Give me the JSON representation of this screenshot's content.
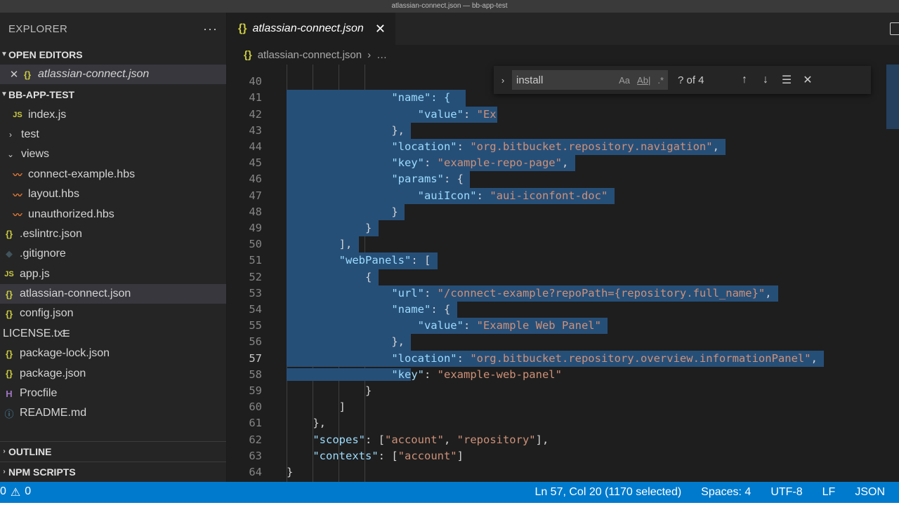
{
  "window": {
    "title": "atlassian-connect.json — bb-app-test"
  },
  "explorer": {
    "title": "EXPLORER",
    "more_icon": "ellipsis-icon",
    "open_editors_label": "OPEN EDITORS",
    "open_editor_file": "atlassian-connect.json",
    "project_label": "BB-APP-TEST",
    "files": [
      {
        "name": "index.js",
        "icon": "js"
      },
      {
        "name": "test",
        "icon": "folder-collapsed"
      },
      {
        "name": "views",
        "icon": "folder-expanded"
      },
      {
        "name": "connect-example.hbs",
        "icon": "hbs"
      },
      {
        "name": "layout.hbs",
        "icon": "hbs"
      },
      {
        "name": "unauthorized.hbs",
        "icon": "hbs"
      },
      {
        "name": ".eslintrc.json",
        "icon": "json"
      },
      {
        "name": ".gitignore",
        "icon": "git"
      },
      {
        "name": "app.js",
        "icon": "js"
      },
      {
        "name": "atlassian-connect.json",
        "icon": "json"
      },
      {
        "name": "config.json",
        "icon": "json"
      },
      {
        "name": "LICENSE.txt",
        "icon": "txt"
      },
      {
        "name": "package-lock.json",
        "icon": "json"
      },
      {
        "name": "package.json",
        "icon": "json"
      },
      {
        "name": "Procfile",
        "icon": "procfile"
      },
      {
        "name": "README.md",
        "icon": "info"
      }
    ],
    "outline_label": "OUTLINE",
    "npm_scripts_label": "NPM SCRIPTS"
  },
  "editor": {
    "tab_label": "atlassian-connect.json",
    "breadcrumb_file": "atlassian-connect.json",
    "breadcrumb_more": "…",
    "lines": {
      "n40": "40",
      "t40a": "\"name\": {",
      "t40b": "Ex",
      "n41": "41",
      "t41k": "\"value\"",
      "t41s": "\"Ex",
      "n42": "42",
      "t42": "},",
      "n43": "43",
      "t43k": "\"location\"",
      "t43s": "\"org.bitbucket.repository.navigation\"",
      "n44": "44",
      "t44k": "\"key\"",
      "t44s": "\"example-repo-page\"",
      "n45": "45",
      "t45k": "\"params\"",
      "t45p": ": {",
      "n46": "46",
      "t46k": "\"auiIcon\"",
      "t46s": "\"aui-iconfont-doc\"",
      "n47": "47",
      "t47": "}",
      "n48": "48",
      "t48": "}",
      "n49": "49",
      "t49": "],",
      "n50": "50",
      "t50k": "\"webPanels\"",
      "t50p": ": [",
      "n51": "51",
      "t51": "{",
      "n52": "52",
      "t52k": "\"url\"",
      "t52s": "\"/connect-example?repoPath={repository.full_name}\"",
      "n53": "53",
      "t53k": "\"name\"",
      "t53p": ": {",
      "n54": "54",
      "t54k": "\"value\"",
      "t54s": "\"Example Web Panel\"",
      "n55": "55",
      "t55": "},",
      "n56": "56",
      "t56k": "\"location\"",
      "t56s": "\"org.bitbucket.repository.overview.informationPanel\"",
      "n57": "57",
      "t57ka": "\"ke",
      "t57kb": "y\"",
      "t57s": "\"example-web-panel\"",
      "n58": "58",
      "t58": "}",
      "n59": "59",
      "t59": "]",
      "n60": "60",
      "t60": "},",
      "n61": "61",
      "t61k": "\"scopes\"",
      "t61a": ": [",
      "t61s1": "\"account\"",
      "t61c": ", ",
      "t61s2": "\"repository\"",
      "t61e": "],",
      "n62": "62",
      "t62k": "\"contexts\"",
      "t62a": ": [",
      "t62s1": "\"account\"",
      "t62e": "]",
      "n63": "63",
      "t63": "}",
      "n64": "64"
    }
  },
  "find_widget": {
    "query": "install",
    "match_case": "Aa",
    "whole_word": "Ab|",
    "regex": ".*",
    "result_count": "? of 4",
    "prev_icon": "arrow-up-icon",
    "next_icon": "arrow-down-icon",
    "selection_icon": "find-in-selection-icon",
    "close_icon": "close-icon"
  },
  "status_bar": {
    "errors": "0",
    "warnings": "0",
    "cursor": "Ln 57, Col 20 (1170 selected)",
    "indent": "Spaces: 4",
    "encoding": "UTF-8",
    "eol": "LF",
    "language": "JSON"
  },
  "colors": {
    "accent": "#007acc",
    "selection": "#264f78",
    "key": "#9cdcfe",
    "string": "#ce9178"
  }
}
